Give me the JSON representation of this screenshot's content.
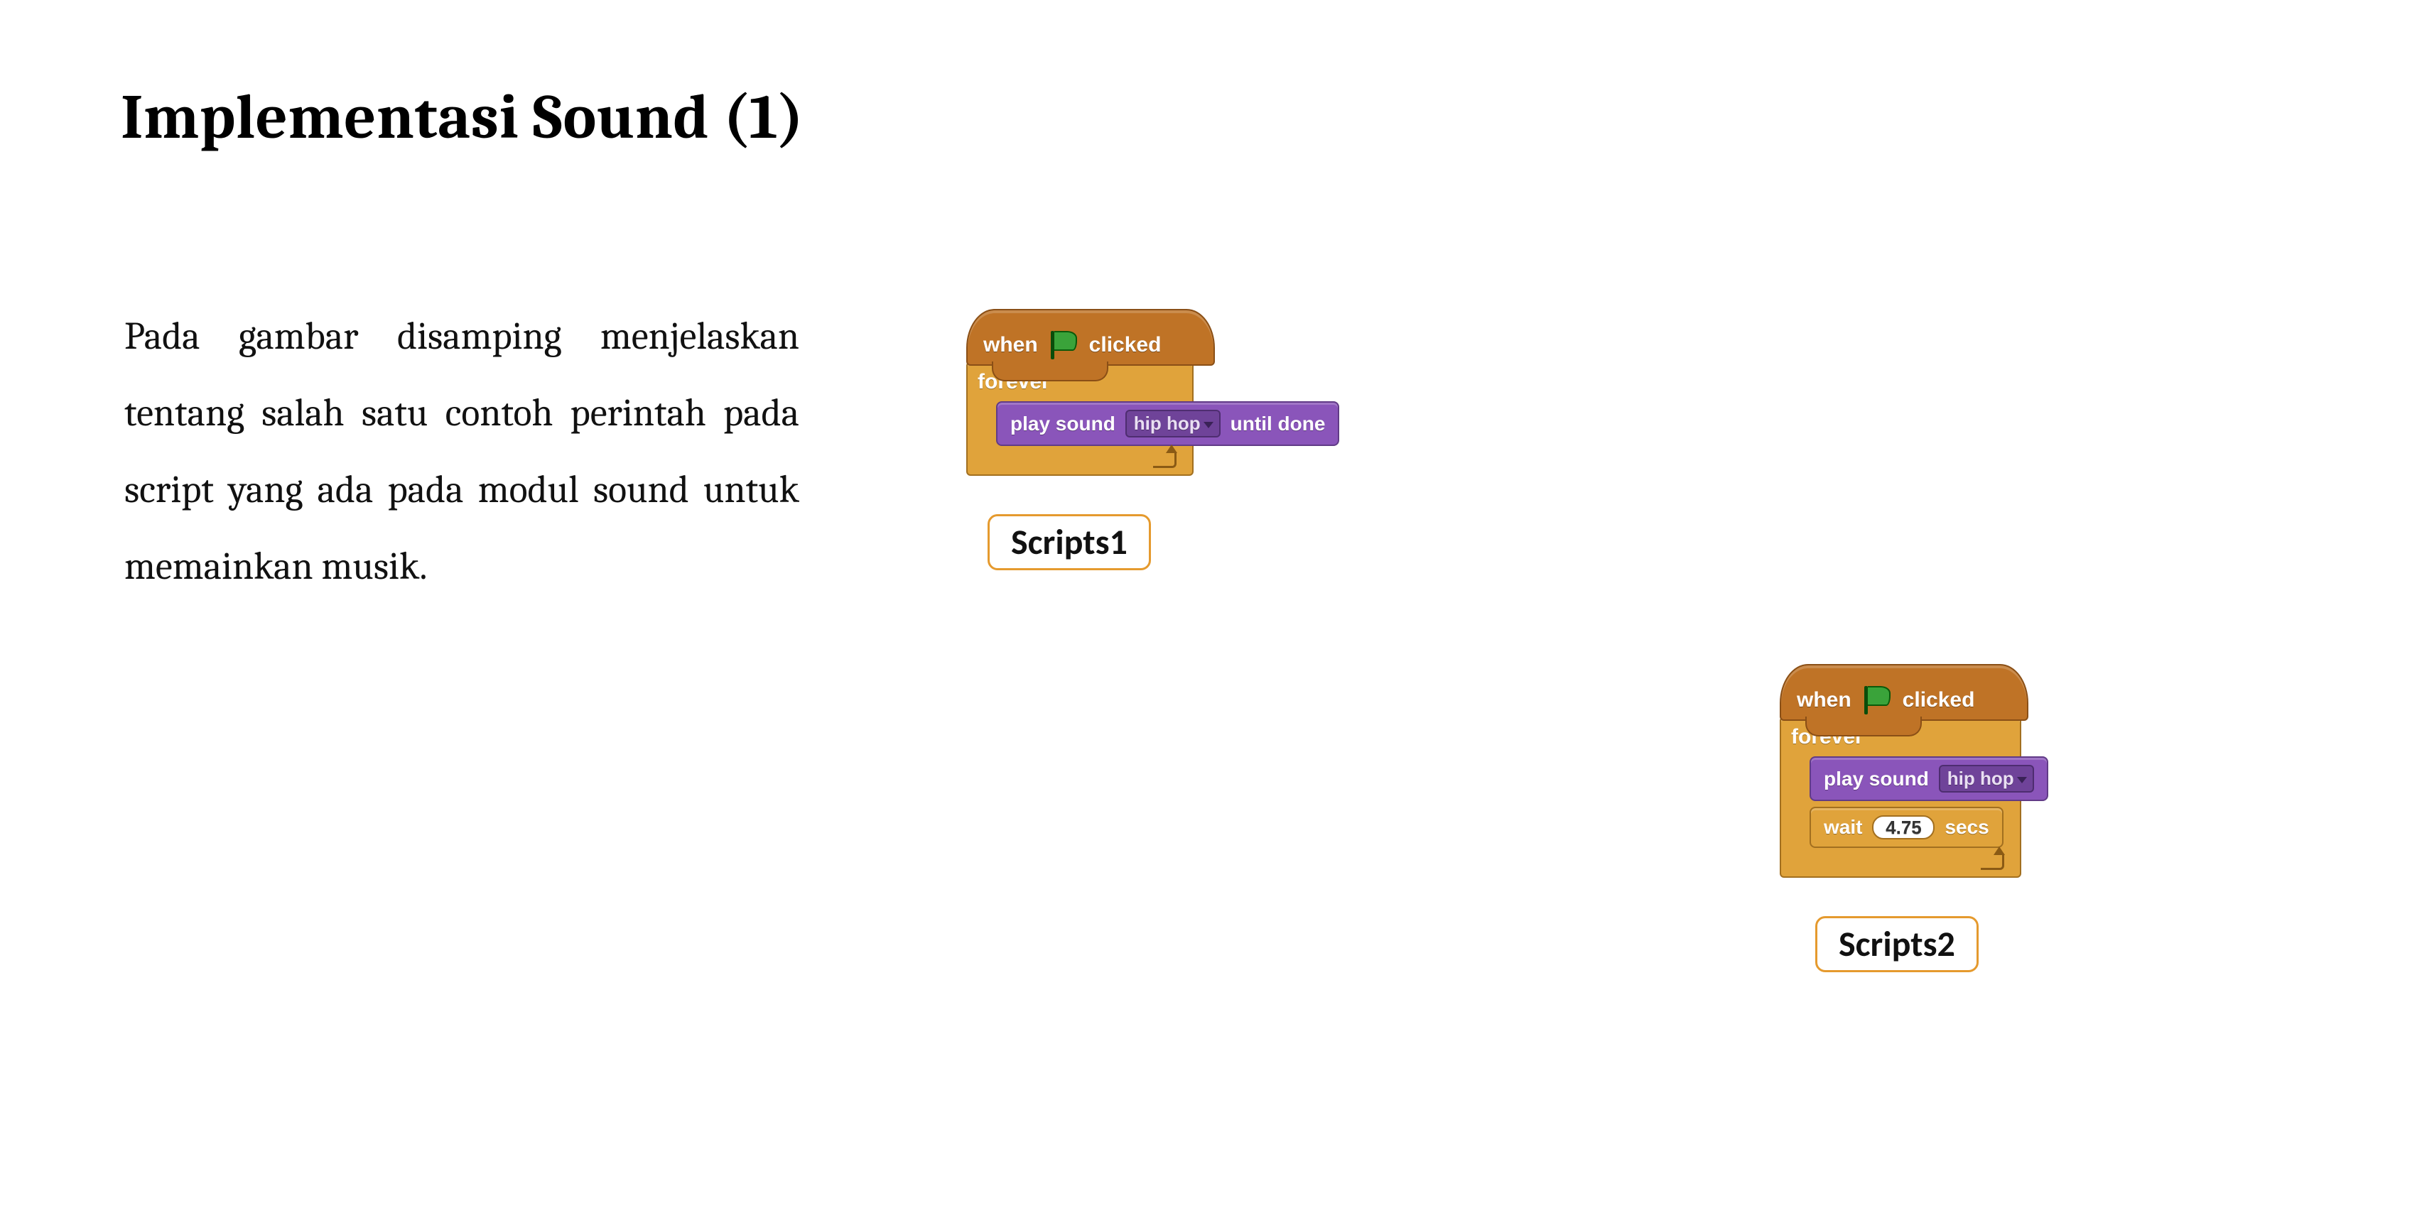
{
  "title": "Implementasi Sound (1)",
  "body_text": "Pada gambar disamping menjelaskan tentang salah satu contoh perintah pada script yang ada pada modul sound untuk memainkan musik.",
  "scripts": {
    "s1": {
      "label": "Scripts1",
      "hat_when": "when",
      "hat_clicked": "clicked",
      "forever": "forever",
      "play_sound": "play sound",
      "sound_name": "hip hop",
      "until_done": "until done"
    },
    "s2": {
      "label": "Scripts2",
      "hat_when": "when",
      "hat_clicked": "clicked",
      "forever": "forever",
      "play_sound": "play sound",
      "sound_name": "hip hop",
      "wait": "wait",
      "wait_value": "4.75",
      "secs": "secs"
    }
  }
}
